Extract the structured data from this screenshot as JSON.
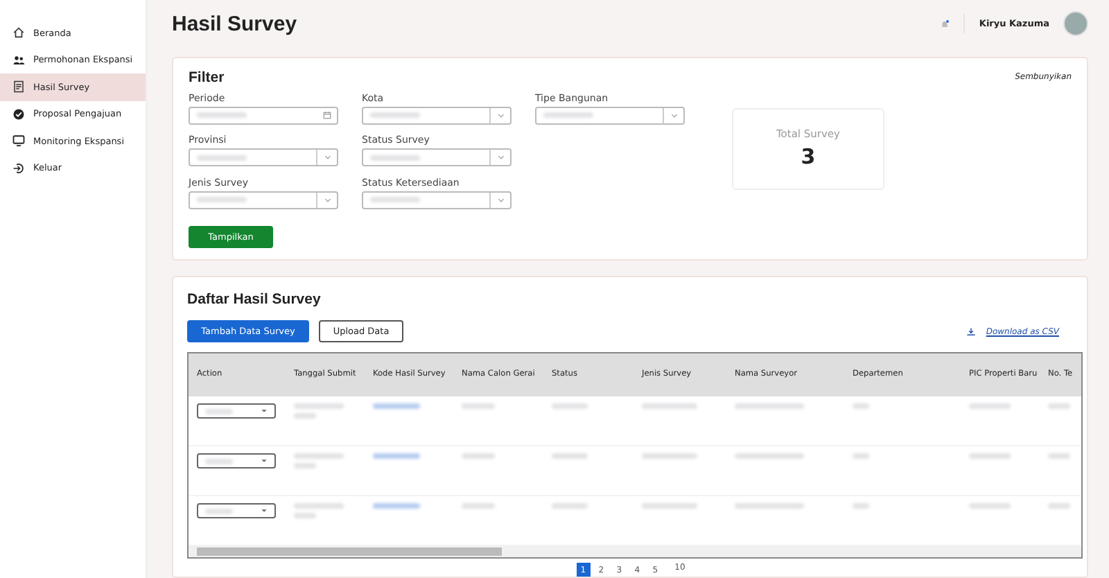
{
  "sidebar": {
    "items": [
      {
        "label": "Beranda",
        "selected": false
      },
      {
        "label": "Permohonan Ekspansi",
        "selected": false
      },
      {
        "label": "Hasil Survey",
        "selected": true
      },
      {
        "label": "Proposal Pengajuan",
        "selected": false
      },
      {
        "label": "Monitoring Ekspansi",
        "selected": false
      },
      {
        "label": "Keluar",
        "selected": false
      }
    ]
  },
  "header": {
    "title": "Hasil Survey",
    "user": "Kiryu Kazuma"
  },
  "filter": {
    "title": "Filter",
    "toggle": "Sembunyikan",
    "fields": [
      {
        "label": "Periode",
        "kind": "date"
      },
      {
        "label": "Kota",
        "kind": "select"
      },
      {
        "label": "Tipe Bangunan",
        "kind": "select"
      },
      {
        "label": "Provinsi",
        "kind": "select"
      },
      {
        "label": "Status Survey",
        "kind": "select"
      },
      {
        "label": "Jenis Survey",
        "kind": "select"
      },
      {
        "label": "Status Ketersediaan",
        "kind": "select"
      }
    ],
    "button": "Tampilkan",
    "stat": {
      "label": "Total Survey",
      "value": "3"
    }
  },
  "list": {
    "title": "Daftar Hasil Survey",
    "primary_button": "Tambah Data Survey",
    "secondary_button": "Upload Data",
    "download": "Download as CSV",
    "columns": [
      "Action",
      "Tanggal Submit",
      "Kode Hasil Survey",
      "Nama Calon Gerai",
      "Status",
      "Jenis Survey",
      "Nama Surveyor",
      "Departemen",
      "PIC Properti Baru",
      "No. Te"
    ],
    "pages": [
      {
        "label": "1",
        "selected": true
      },
      {
        "label": "2",
        "selected": false
      },
      {
        "label": "3",
        "selected": false
      },
      {
        "label": "4",
        "selected": false
      },
      {
        "label": "5",
        "selected": false
      }
    ],
    "page_size": "10"
  }
}
